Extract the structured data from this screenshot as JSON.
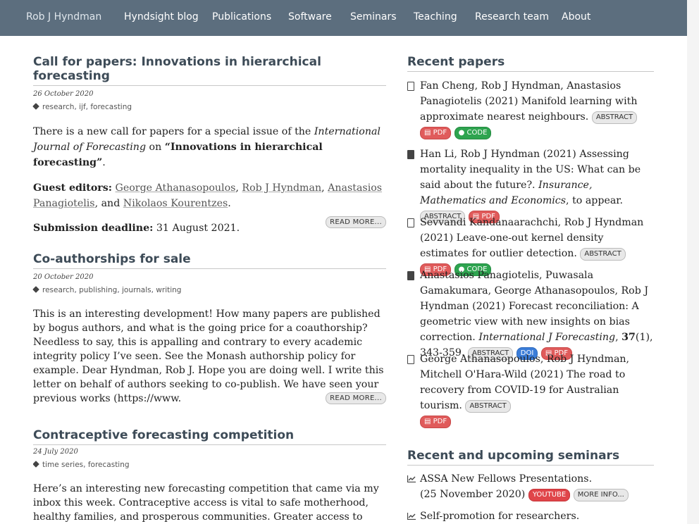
{
  "nav": {
    "brand": "Rob J Hyndman",
    "items": [
      "Hyndsight blog",
      "Publications",
      "Software",
      "Seminars",
      "Teaching",
      "Research team",
      "About"
    ]
  },
  "posts": [
    {
      "title": "Call for papers: Innovations in hierarchical forecasting",
      "date": "26 October 2020",
      "tags": [
        "research",
        "ijf",
        "forecasting"
      ],
      "p1_a": "There is a new call for papers for a special issue of the ",
      "p1_journal": "International Journal of Forecasting",
      "p1_b": " on ",
      "p1_topic": "“Innovations in hierarchical forecasting”",
      "p1_end": ".",
      "editors_label": "Guest editors:",
      "editors": [
        "George Athanasopoulos",
        "Rob J Hyndman",
        "Anastasios Panagiotelis",
        "Nikolaos Kourentzes"
      ],
      "and": ", and ",
      "comma": ", ",
      "period": ".",
      "deadline_label": "Submission deadline:",
      "deadline": " 31 August 2021.",
      "read_more": "READ MORE..."
    },
    {
      "title": "Co-authorships for sale",
      "date": "20 October 2020",
      "tags": [
        "research",
        "publishing",
        "journals",
        "writing"
      ],
      "excerpt": "This is an interesting development! How many papers are published by bogus authors, and what is the going price for a coauthorship? Needless to say, this is appalling and contrary to every academic integrity policy I’ve seen. See the Monash authorship policy for example. Dear Hyndman, Rob J. Hope you are doing well. I write this letter on behalf of authors seeking to co-publish. We have seen your previous works (https://www.",
      "read_more": "READ MORE..."
    },
    {
      "title": "Contraceptive forecasting competition",
      "date": "24 July 2020",
      "tags": [
        "time series",
        "forecasting"
      ],
      "excerpt": "Here’s an interesting new forecasting competition that came via my inbox this week. Contraceptive access is vital to safe motherhood, healthy families, and prosperous communities. Greater access to contraceptives"
    }
  ],
  "sidebar": {
    "papers_title": "Recent papers",
    "papers": [
      {
        "authors": "Fan Cheng, Rob J Hyndman, Anastasios Panagiotelis (2021) Manifold learning with approximate nearest neighbours. ",
        "venue": "",
        "tail": ""
      },
      {
        "authors": "Han Li, Rob J Hyndman (2021) Assessing mortality inequality in the US: What can be said about the future?. ",
        "venue": "Insurance, Mathematics and Economics",
        "tail": ", to appear. "
      },
      {
        "authors": "Sevvandi Kandanaarachchi, Rob J Hyndman (2021) Leave-one-out kernel density estimates for outlier detection. ",
        "venue": "",
        "tail": ""
      },
      {
        "authors": "Anastasios Panagiotelis, Puwasala Gamakumara, George Athanasopoulos, Rob J Hyndman (2021) Forecast reconciliation: A geometric view with new insights on bias correction. ",
        "venue": "International J Forecasting",
        "tail_vol": "37",
        "tail": "(1), 343-359. "
      },
      {
        "authors": "George Athanasopoulos, Rob J Hyndman, Mitchell O'Hara-Wild (2021) The road to recovery from COVID-19 for Australian tourism. ",
        "venue": "",
        "tail": ""
      }
    ],
    "badges": {
      "abstract": "ABSTRACT",
      "pdf": "PDF",
      "code": "CODE",
      "doi": "DOI",
      "youtube": "YOUTUBE",
      "more_info": "MORE INFO..."
    },
    "seminars_title": "Recent and upcoming seminars",
    "seminars": [
      {
        "title": "ASSA New Fellows Presentations.",
        "date": "(25 November 2020)"
      },
      {
        "title": "Self-promotion for researchers.",
        "date": ""
      }
    ],
    "comma": ", "
  }
}
